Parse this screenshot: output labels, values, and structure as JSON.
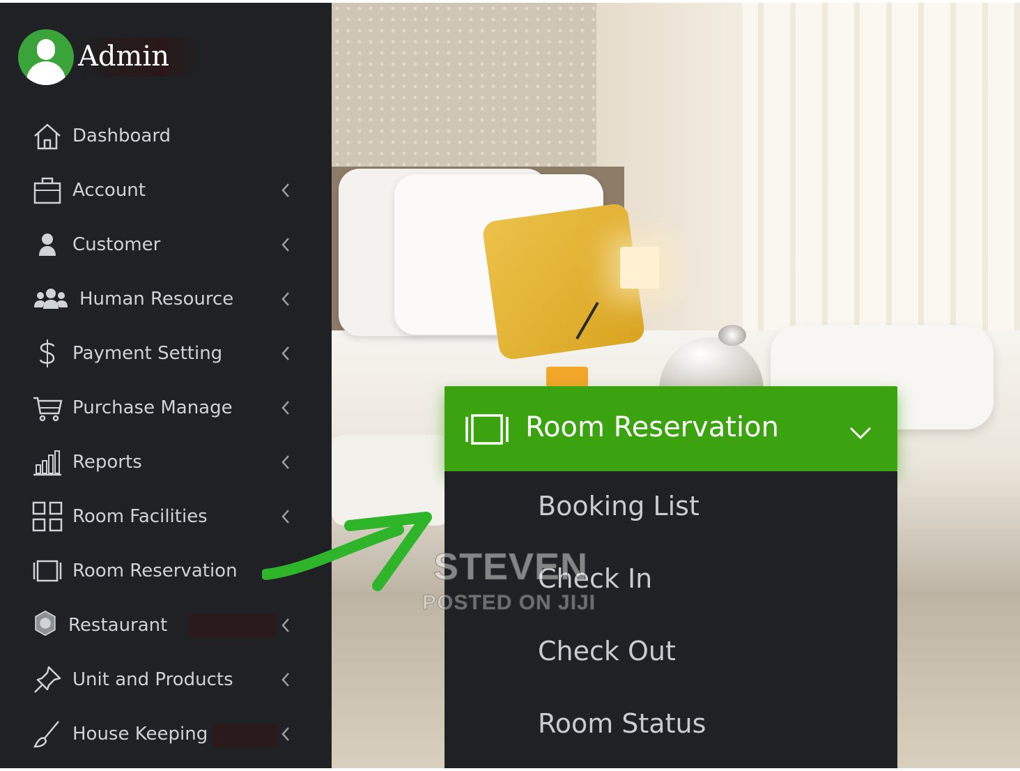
{
  "user": {
    "name": "Admin"
  },
  "sidebar": {
    "items": [
      {
        "label": "Dashboard",
        "icon": "home-icon",
        "has_submenu": false
      },
      {
        "label": "Account",
        "icon": "briefcase-icon",
        "has_submenu": true
      },
      {
        "label": "Customer",
        "icon": "user-icon",
        "has_submenu": true
      },
      {
        "label": "Human Resource",
        "icon": "users-icon",
        "has_submenu": true
      },
      {
        "label": "Payment Setting",
        "icon": "dollar-icon",
        "has_submenu": true
      },
      {
        "label": "Purchase Manage",
        "icon": "cart-icon",
        "has_submenu": true
      },
      {
        "label": "Reports",
        "icon": "bar-chart-icon",
        "has_submenu": true
      },
      {
        "label": "Room Facilities",
        "icon": "grid-icon",
        "has_submenu": true
      },
      {
        "label": "Room Reservation",
        "icon": "tablet-icon",
        "has_submenu": false
      },
      {
        "label": "Restaurant",
        "icon": "restaurant-icon",
        "has_submenu": true
      },
      {
        "label": "Unit and Products",
        "icon": "pin-icon",
        "has_submenu": true
      },
      {
        "label": "House Keeping",
        "icon": "broom-icon",
        "has_submenu": true
      }
    ]
  },
  "popup": {
    "title": "Room Reservation",
    "icon": "tablet-icon",
    "submenu": [
      "Booking List",
      "Check In",
      "Check Out",
      "Room Status"
    ]
  },
  "watermark": {
    "line1": "STEVEN",
    "line2": "POSTED ON JIJI"
  },
  "colors": {
    "accent": "#3aa30f",
    "sidebar_bg": "#1f2124",
    "avatar": "#3aa339",
    "arrow": "#2fb52a"
  }
}
